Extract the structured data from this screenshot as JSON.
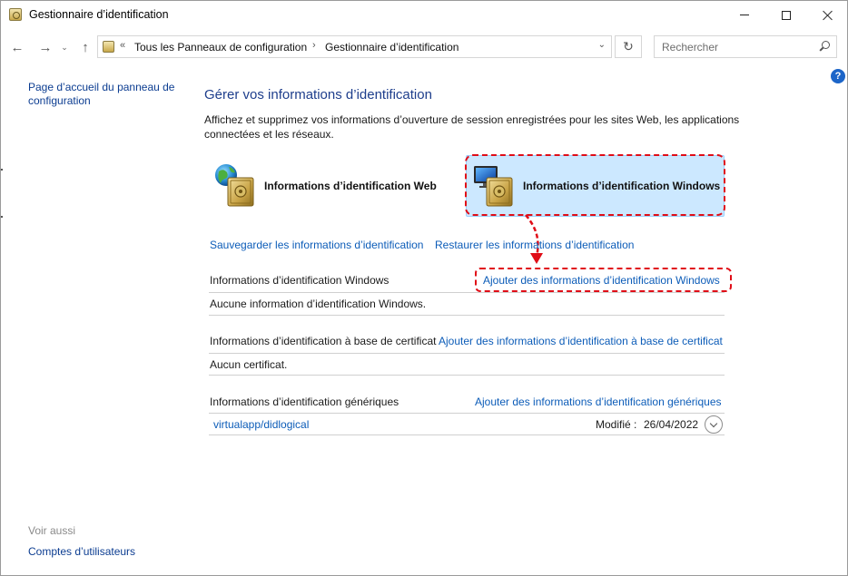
{
  "window": {
    "title": "Gestionnaire d’identification"
  },
  "nav": {
    "address_chevron": "«",
    "address_segments": [
      "Tous les Panneaux de configuration",
      "Gestionnaire d’identification"
    ],
    "address_separator": "›",
    "search_placeholder": "Rechercher"
  },
  "sidebar": {
    "home_link": "Page d’accueil du panneau de configuration",
    "see_also": "Voir aussi",
    "user_accounts_link": "Comptes d’utilisateurs"
  },
  "main": {
    "title": "Gérer vos informations d’identification",
    "description": "Affichez et supprimez vos informations d’ouverture de session enregistrées pour les sites Web, les applications connectées et les réseaux.",
    "tiles": {
      "web": "Informations d’identification Web",
      "windows": "Informations d’identification Windows"
    },
    "backup_link": "Sauvegarder les informations d’identification",
    "restore_link": "Restaurer les informations d’identification",
    "sections": {
      "windows": {
        "heading": "Informations d’identification Windows",
        "add_link": "Ajouter des informations d’identification Windows",
        "empty": "Aucune information d’identification Windows."
      },
      "certificate": {
        "heading": "Informations d’identification à base de certificat",
        "add_link": "Ajouter des informations d’identification à base de certificat",
        "empty": "Aucun certificat."
      },
      "generic": {
        "heading": "Informations d’identification génériques",
        "add_link": "Ajouter des informations d’identification génériques",
        "items": [
          {
            "name": "virtualapp/didlogical",
            "modified_label": "Modifié :",
            "modified_date": "26/04/2022"
          }
        ]
      }
    }
  },
  "colors": {
    "link": "#0c5cb8",
    "title": "#1e3e8c",
    "selected_tile": "#cce8ff",
    "annotation": "#e00d17"
  },
  "icons": {
    "web_tile": "globe-vault-icon",
    "windows_tile": "monitor-vault-icon",
    "help": "help-icon"
  }
}
